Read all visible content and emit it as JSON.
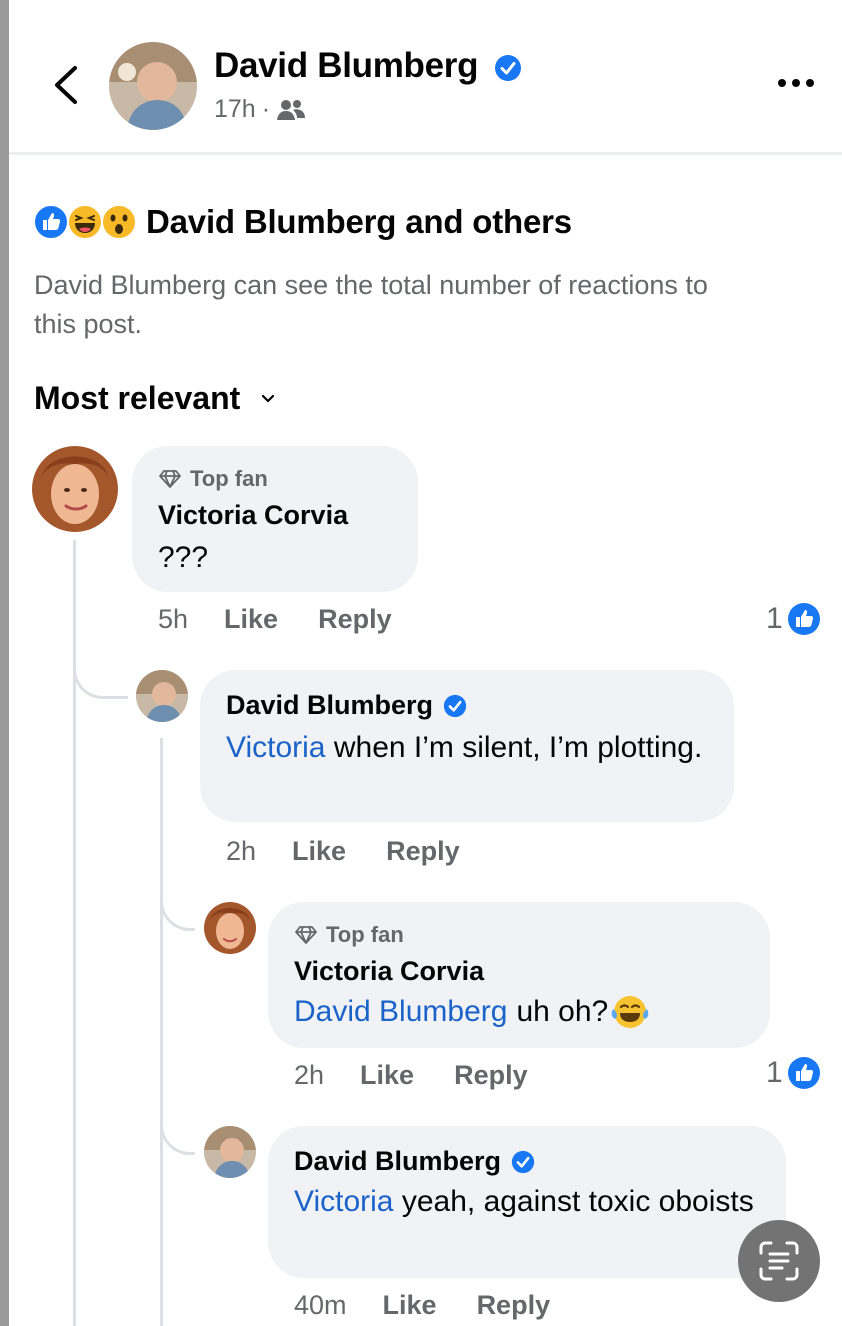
{
  "header": {
    "author_name": "David Blumberg",
    "time": "17h",
    "separator": "·",
    "audience_icon": "friends-icon",
    "back_icon": "chevron-left-icon",
    "more_icon": "more-dots-icon"
  },
  "reactions": {
    "icons": [
      "like-reaction-icon",
      "haha-reaction-icon",
      "wow-reaction-icon"
    ],
    "title": "David Blumberg and others",
    "note": "David Blumberg can see the total number of reactions to this post."
  },
  "sort": {
    "label": "Most relevant",
    "icon": "chevron-down-icon"
  },
  "comments": [
    {
      "badge": "Top fan",
      "author": "Victoria Corvia",
      "mention": "",
      "text": "???",
      "time": "5h",
      "like_label": "Like",
      "reply_label": "Reply",
      "like_count": "1"
    },
    {
      "author": "David Blumberg",
      "verified": true,
      "mention": "Victoria",
      "text": "when I’m silent, I’m plotting.",
      "time": "2h",
      "like_label": "Like",
      "reply_label": "Reply"
    },
    {
      "badge": "Top fan",
      "author": "Victoria Corvia",
      "mention": "David Blumberg",
      "text": "uh oh?",
      "emoji_icon": "tears-of-joy-emoji-icon",
      "time": "2h",
      "like_label": "Like",
      "reply_label": "Reply",
      "like_count": "1"
    },
    {
      "author": "David Blumberg",
      "verified": true,
      "mention": "Victoria",
      "text": "yeah, against toxic oboists",
      "time": "40m",
      "like_label": "Like",
      "reply_label": "Reply"
    }
  ],
  "colors": {
    "accent_blue": "#1877f2",
    "mention_blue": "#1b63c9",
    "bubble_bg": "#f0f2f5",
    "secondary_text": "#65676b"
  },
  "floating_button_icon": "text-scan-icon"
}
